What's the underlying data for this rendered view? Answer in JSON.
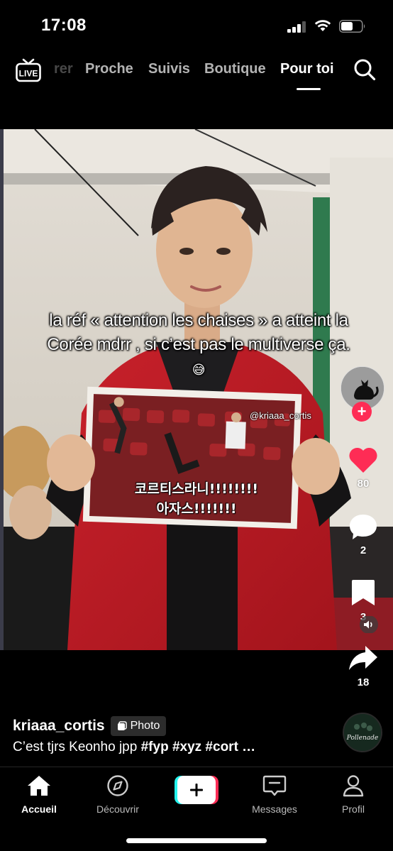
{
  "status_bar": {
    "time": "17:08"
  },
  "top_nav": {
    "live_label": "LIVE",
    "tabs": [
      {
        "label": "rer"
      },
      {
        "label": "Proche"
      },
      {
        "label": "Suivis"
      },
      {
        "label": "Boutique"
      },
      {
        "label": "Pour toi"
      }
    ],
    "active_tab": "Pour toi"
  },
  "post": {
    "overlay_caption": "la réf « attention les chaises » a atteint la Corée mdrr , si c’est pas le multiverse ça.",
    "overlay_emoji": "😅",
    "watermark": "@kriaaa_cortis",
    "sign_text_line1": "코르티스라니!!!!!!!!",
    "sign_text_line2": "아자스!!!!!!!",
    "likes": "80",
    "comments": "2",
    "saves": "3",
    "shares": "18",
    "author": "kriaaa_cortis",
    "badge": "Photo",
    "description": "C’est tjrs Keonho jpp",
    "hashtags": "#fyp #xyz #cort …",
    "music_cover_text": "Pollenade"
  },
  "bottom_nav": {
    "items": [
      {
        "label": "Accueil"
      },
      {
        "label": "Découvrir"
      },
      {
        "label": "Messages"
      },
      {
        "label": "Profil"
      }
    ]
  },
  "colors": {
    "accent": "#fe2c55",
    "cyan": "#25f4ee",
    "background": "#000000"
  }
}
